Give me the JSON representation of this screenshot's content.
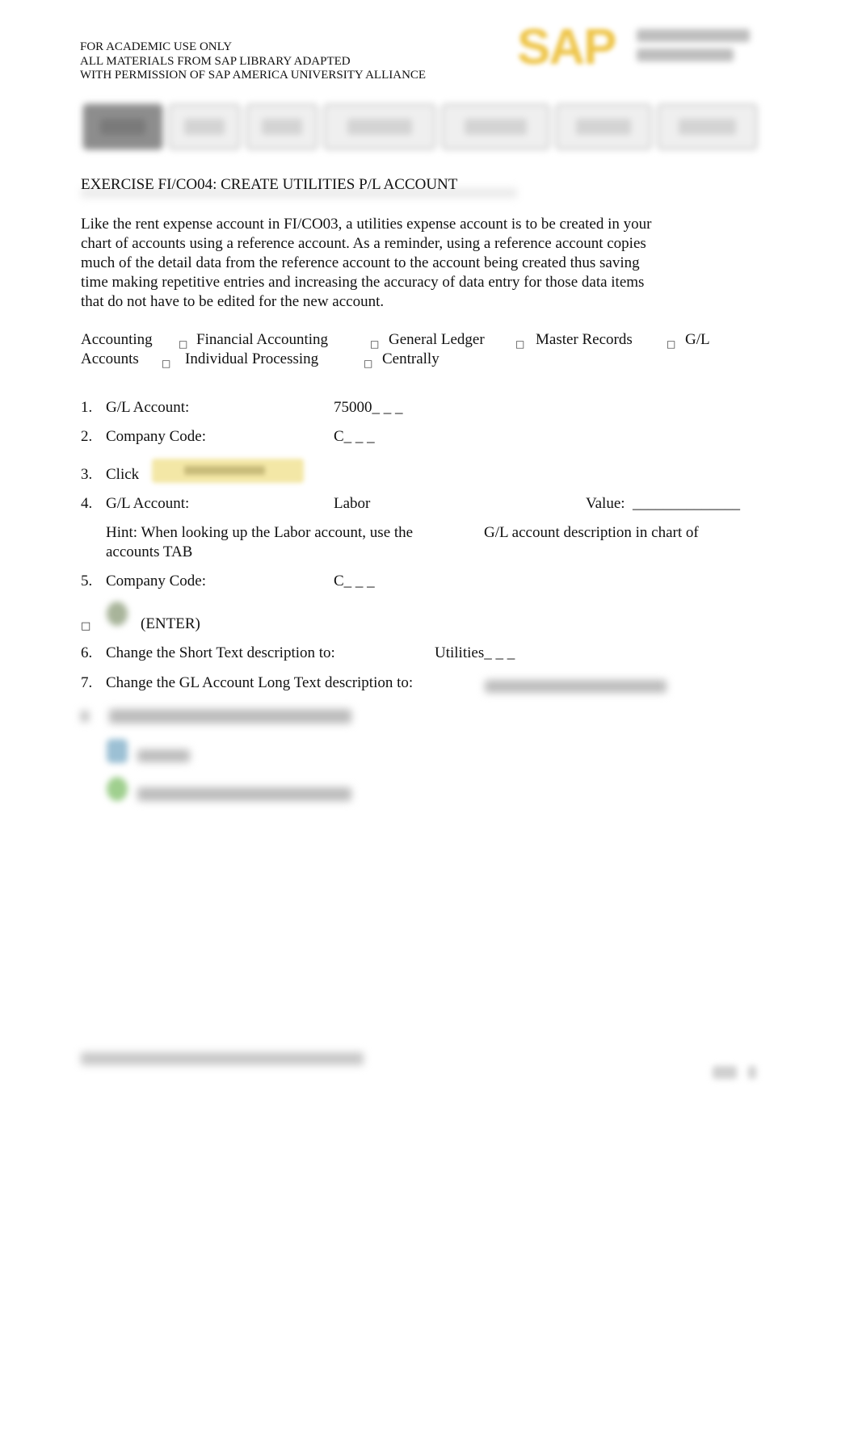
{
  "header": {
    "lines": [
      "FOR ACADEMIC USE ONLY",
      "ALL MATERIALS FROM SAP LIBRARY ADAPTED",
      "WITH PERMISSION OF SAP AMERICA UNIVERSITY ALLIANCE"
    ],
    "logo": {
      "brand": "SAP",
      "brand_color": "#eec54a"
    }
  },
  "toolbar": {
    "button_count": 7,
    "active_index": 0
  },
  "title": "EXERCISE FI/CO04: CREATE UTILITIES P/L ACCOUNT",
  "intro": [
    "Like the rent expense account in FI/CO03, a utilities expense account is to be created in your",
    "chart of accounts using a reference account. As a reminder, using a reference account copies",
    "much of the detail data from the reference account to the account being created thus saving",
    "time making repetitive entries and increasing the accuracy of data entry for those data items",
    "that do not have to be edited for the new account."
  ],
  "menu_path": {
    "separator_icon": "arrow-right-icon",
    "separator": "□",
    "items": [
      "Accounting",
      "Financial Accounting",
      "General Ledger",
      "Master Records",
      "G/L",
      "Accounts",
      "Individual Processing",
      "Centrally"
    ]
  },
  "steps": [
    {
      "num": "1.",
      "label": "G/L Account:",
      "value": "75000_ _ _"
    },
    {
      "num": "2.",
      "label": "Company Code:",
      "value": "C_ _ _"
    },
    {
      "num": "3.",
      "label": "Click",
      "button": "blurred-button"
    },
    {
      "num": "4.",
      "label": "G/L Account:",
      "value": "Labor",
      "extra_label": "Value:",
      "extra_value": "______________"
    },
    {
      "hint_line1a": "Hint:  When looking up the Labor account, use the",
      "hint_line1b": "G/L account description in chart of",
      "hint_line2": "accounts TAB"
    },
    {
      "num": "5.",
      "label": "Company Code:",
      "value": "C_ _ _"
    },
    {
      "num": "□",
      "label": "(ENTER)",
      "icon": "enter-icon"
    },
    {
      "num": "6.",
      "label": "Change the Short Text description to:",
      "value": "Utilities_ _ _"
    },
    {
      "num": "7.",
      "label": "Change the GL Account Long Text description to:",
      "value": ""
    }
  ]
}
